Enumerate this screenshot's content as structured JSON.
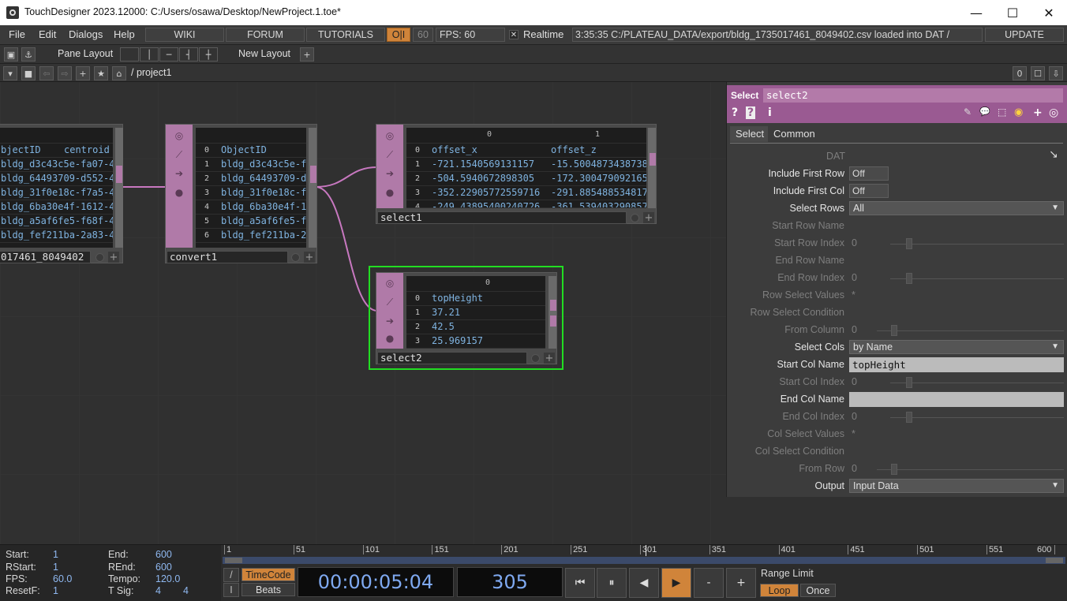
{
  "window": {
    "title": "TouchDesigner 2023.12000: C:/Users/osawa/Desktop/NewProject.1.toe*",
    "min_glyph": "—",
    "max_glyph": "☐",
    "close_glyph": "✕"
  },
  "menubar": {
    "menus": [
      "File",
      "Edit",
      "Dialogs",
      "Help"
    ],
    "wiki": "WIKI",
    "forum": "FORUM",
    "tutorials": "TUTORIALS",
    "oi": "O|I",
    "fps_box": "60",
    "fps_label": "FPS:  60",
    "realtime": "Realtime",
    "realtime_check": "✕",
    "status": "3:35:35 C:/PLATEAU_DATA/export/bldg_1735017461_8049402.csv loaded into DAT /",
    "update": "UPDATE"
  },
  "panebar": {
    "pane_layout": "Pane Layout",
    "new_layout": "New Layout",
    "plus": "+"
  },
  "pathbar": {
    "path": "/ project1",
    "counter": "0"
  },
  "nodes": {
    "file_dat": {
      "name": "017461_8049402",
      "header": [
        "bjectID",
        "centroid"
      ],
      "rows": [
        "bldg_d3c43c5e-fa07-4",
        "bldg_64493709-d552-4",
        "bldg_31f0e18c-f7a5-4",
        "bldg_6ba30e4f-1612-4",
        "bldg_a5af6fe5-f68f-4",
        "bldg_fef211ba-2a83-4"
      ]
    },
    "convert1": {
      "name": "convert1",
      "rows": [
        {
          "i": "0",
          "v": "ObjectID"
        },
        {
          "i": "1",
          "v": "bldg_d3c43c5e-f"
        },
        {
          "i": "2",
          "v": "bldg_64493709-d"
        },
        {
          "i": "3",
          "v": "bldg_31f0e18c-f"
        },
        {
          "i": "4",
          "v": "bldg_6ba30e4f-1"
        },
        {
          "i": "5",
          "v": "bldg_a5af6fe5-f"
        },
        {
          "i": "6",
          "v": "bldg_fef211ba-2"
        }
      ]
    },
    "select1": {
      "name": "select1",
      "col_headers": [
        "0",
        "1"
      ],
      "rows": [
        {
          "i": "0",
          "a": "offset_x",
          "b": "offset_z"
        },
        {
          "i": "1",
          "a": "-721.1540569131157",
          "b": "-15.5004873438738"
        },
        {
          "i": "2",
          "a": "-504.5940672898305",
          "b": "-172.300479092165"
        },
        {
          "i": "3",
          "a": "-352.22905772559716",
          "b": "-291.885488534817"
        },
        {
          "i": "4",
          "a": "-249.43895400240726",
          "b": "-361.539403290857"
        }
      ]
    },
    "select2": {
      "name": "select2",
      "col_headers": [
        "0"
      ],
      "rows": [
        {
          "i": "0",
          "v": "topHeight"
        },
        {
          "i": "1",
          "v": "37.21"
        },
        {
          "i": "2",
          "v": "42.5"
        },
        {
          "i": "3",
          "v": "25.969157"
        }
      ]
    },
    "side_icons": [
      "◎",
      "⟋",
      "➔",
      "●"
    ]
  },
  "params": {
    "op_type": "Select",
    "op_name": "select2",
    "header_icons": [
      "?",
      "?",
      "i"
    ],
    "right_icons": [
      "✎",
      "💬",
      "⬚",
      "◉",
      "+",
      "◎"
    ],
    "tabs": [
      "Select",
      "Common"
    ],
    "dat_label": "DAT",
    "rows": {
      "include_first_row": {
        "label": "Include First Row",
        "value": "Off"
      },
      "include_first_col": {
        "label": "Include First Col",
        "value": "Off"
      },
      "select_rows": {
        "label": "Select Rows",
        "value": "All"
      },
      "start_row_name": {
        "label": "Start Row Name"
      },
      "start_row_index": {
        "label": "Start Row Index",
        "value": "0"
      },
      "end_row_name": {
        "label": "End Row  Name"
      },
      "end_row_index": {
        "label": "End Row Index",
        "value": "0"
      },
      "row_select_values": {
        "label": "Row Select Values",
        "value": "*"
      },
      "row_select_condition": {
        "label": "Row Select Condition"
      },
      "from_column": {
        "label": "From Column",
        "value": "0"
      },
      "select_cols": {
        "label": "Select Cols",
        "value": "by Name"
      },
      "start_col_name": {
        "label": "Start Col Name",
        "value": "topHeight"
      },
      "start_col_index": {
        "label": "Start Col Index",
        "value": "0"
      },
      "end_col_name": {
        "label": "End Col Name",
        "value": ""
      },
      "end_col_index": {
        "label": "End Col Index",
        "value": "0"
      },
      "col_select_values": {
        "label": "Col Select Values",
        "value": "*"
      },
      "col_select_condition": {
        "label": "Col Select Condition"
      },
      "from_row": {
        "label": "From Row",
        "value": "0"
      },
      "output": {
        "label": "Output",
        "value": "Input Data"
      }
    }
  },
  "timeline": {
    "start_label": "Start:",
    "start": "1",
    "end_label": "End:",
    "end": "600",
    "rstart_label": "RStart:",
    "rstart": "1",
    "rend_label": "REnd:",
    "rend": "600",
    "fps_label": "FPS:",
    "fps": "60.0",
    "tempo_label": "Tempo:",
    "tempo": "120.0",
    "resetf_label": "ResetF:",
    "resetf": "1",
    "tsig_label": "T Sig:",
    "tsig_a": "4",
    "tsig_b": "4",
    "ruler": [
      "1",
      "51",
      "101",
      "151",
      "201",
      "251",
      "301",
      "351",
      "401",
      "451",
      "501",
      "551",
      "600"
    ],
    "current_frame": 305,
    "range_start": 1,
    "range_end": 600,
    "timecode_btn": "TimeCode",
    "beats_btn": "Beats",
    "timecode": "00:00:05:04",
    "frame": "305",
    "range_limit": "Range Limit",
    "loop": "Loop",
    "once": "Once",
    "slash": "/",
    "bar": "I",
    "transport": [
      "⏮",
      "⏸",
      "◀",
      "▶",
      "-",
      "+"
    ]
  }
}
